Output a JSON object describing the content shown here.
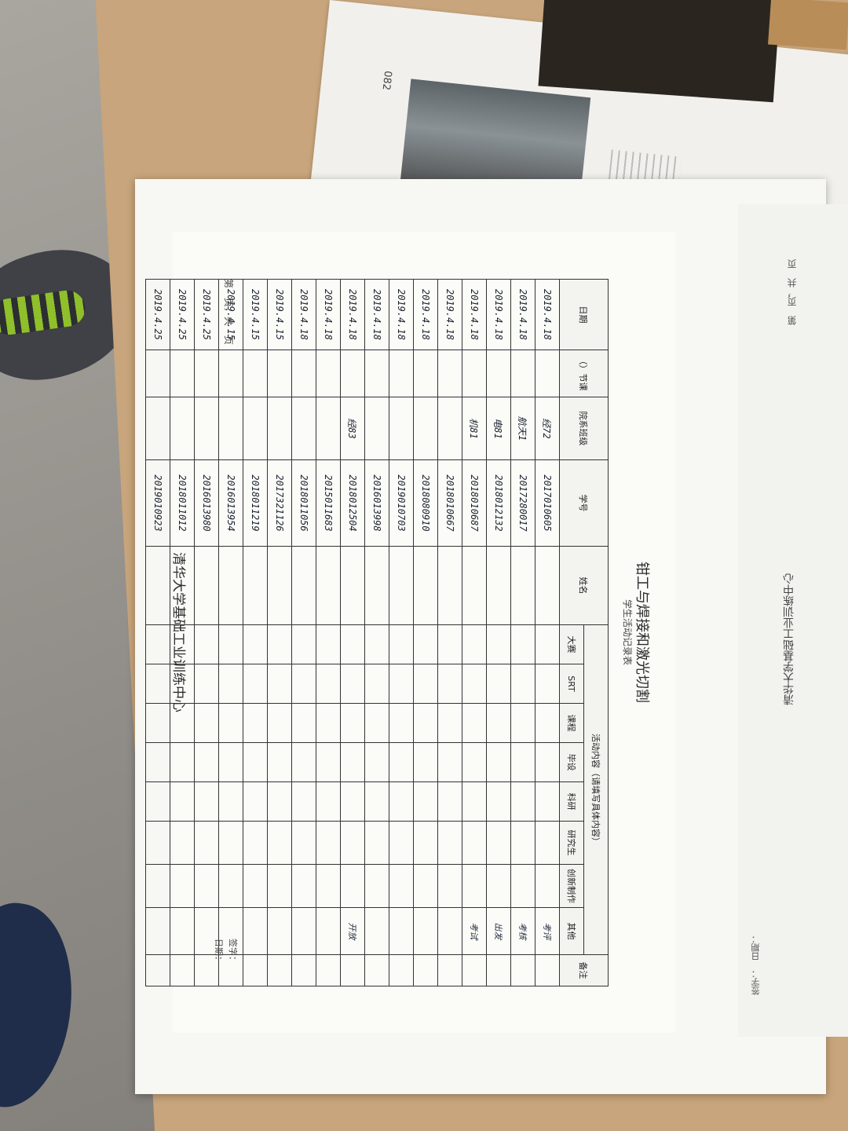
{
  "form": {
    "title": "钳工与焊接和激光切割",
    "subtitle": "学生活动记录表",
    "headers": {
      "date": "日期",
      "section": "（）节课",
      "cls": "院系班级",
      "student_id": "学号",
      "name": "姓名",
      "activity_group": "活动内容（请填写具体内容）",
      "activities": [
        "大赛",
        "SRT",
        "课程",
        "毕设",
        "科研",
        "研究生",
        "创新制作",
        "其他"
      ],
      "remark": "备注"
    },
    "rows": [
      {
        "date": "2019.4.18",
        "section": "",
        "cls": "经72",
        "student_id": "2017010605",
        "name": "",
        "other": "考评"
      },
      {
        "date": "2019.4.18",
        "section": "",
        "cls": "航天1",
        "student_id": "2017280017",
        "name": "",
        "other": "考核"
      },
      {
        "date": "2019.4.18",
        "section": "",
        "cls": "电81",
        "student_id": "2018012132",
        "name": "",
        "other": "出发"
      },
      {
        "date": "2019.4.18",
        "section": "",
        "cls": "机81",
        "student_id": "2018010687",
        "name": "",
        "other": "考试"
      },
      {
        "date": "2019.4.18",
        "section": "",
        "cls": "",
        "student_id": "2018010667",
        "name": "",
        "other": ""
      },
      {
        "date": "2019.4.18",
        "section": "",
        "cls": "",
        "student_id": "2018080910",
        "name": "",
        "other": ""
      },
      {
        "date": "2019.4.18",
        "section": "",
        "cls": "",
        "student_id": "2019010703",
        "name": "",
        "other": ""
      },
      {
        "date": "2019.4.18",
        "section": "",
        "cls": "",
        "student_id": "2016013998",
        "name": "",
        "other": ""
      },
      {
        "date": "2019.4.18",
        "section": "",
        "cls": "经83",
        "student_id": "2018012504",
        "name": "",
        "other": "开放"
      },
      {
        "date": "2019.4.18",
        "section": "",
        "cls": "",
        "student_id": "2015011683",
        "name": "",
        "other": ""
      },
      {
        "date": "2019.4.18",
        "section": "",
        "cls": "",
        "student_id": "2018011056",
        "name": "",
        "other": ""
      },
      {
        "date": "2019.4.15",
        "section": "",
        "cls": "",
        "student_id": "2017321126",
        "name": "",
        "other": ""
      },
      {
        "date": "2019.4.15",
        "section": "",
        "cls": "",
        "student_id": "2018011219",
        "name": "",
        "other": ""
      },
      {
        "date": "2019.4.15",
        "section": "",
        "cls": "",
        "student_id": "2016013954",
        "name": "",
        "other": ""
      },
      {
        "date": "2019.4.25",
        "section": "",
        "cls": "",
        "student_id": "2016013980",
        "name": "",
        "other": ""
      },
      {
        "date": "2019.4.25",
        "section": "",
        "cls": "",
        "student_id": "2018011012",
        "name": "",
        "other": ""
      },
      {
        "date": "2019.4.25",
        "section": "",
        "cls": "",
        "student_id": "2019010923",
        "name": "",
        "other": ""
      }
    ],
    "footer_org": "清华大学基础工业训练中心",
    "page_label": "第　页，共　页",
    "sign_label": "签字：",
    "date_label": "日期："
  },
  "right_page": {
    "org": "清华大学基础工业训练中心",
    "page_label": "第　页，共　页",
    "sign_label": "签字：　日期："
  },
  "back_page": {
    "number": "082"
  }
}
